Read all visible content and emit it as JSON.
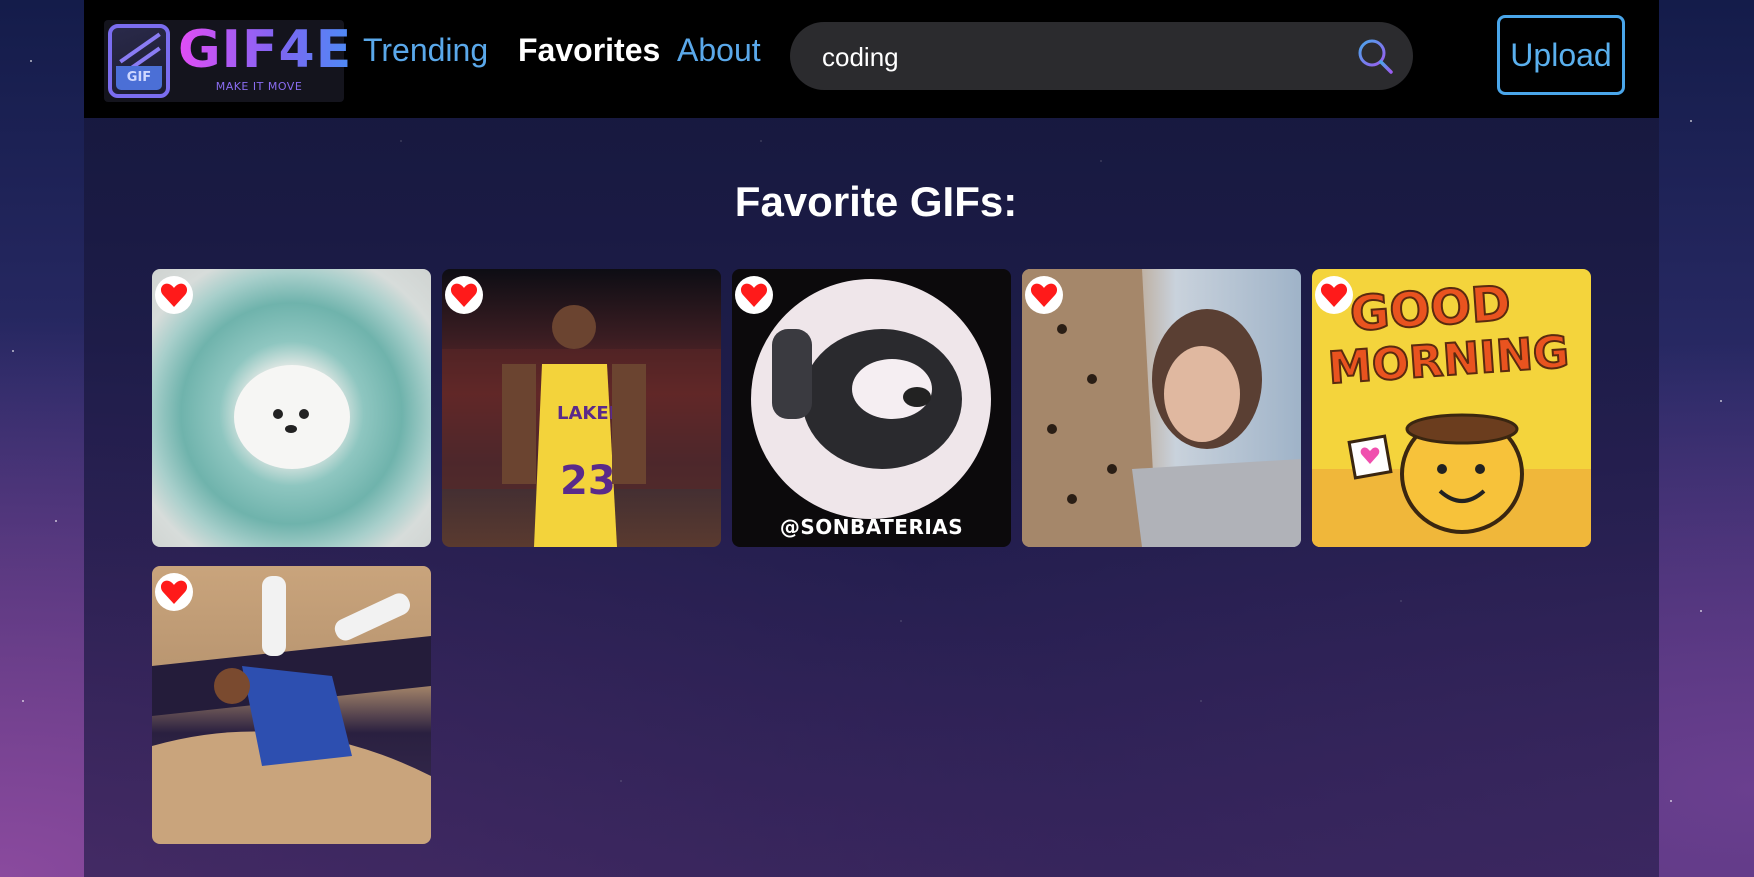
{
  "brand": {
    "logo_word": "GIF4E",
    "logo_tagline": "MAKE IT MOVE",
    "logo_badge": "GIF"
  },
  "nav": {
    "trending": "Trending",
    "favorites": "Favorites",
    "about": "About"
  },
  "search": {
    "value": "coding"
  },
  "upload_label": "Upload",
  "heading": "Favorite GIFs:",
  "gifs": [
    {
      "subject": "fluffy white dog in teal bowl"
    },
    {
      "subject": "basketball player in Lakers 23 jersey"
    },
    {
      "subject": "raccoon waving",
      "caption": "@SONBATERIAS"
    },
    {
      "subject": "cheetah nuzzling woman"
    },
    {
      "subject": "Good Morning tea cup cartoon",
      "line1": "GOOD",
      "line2": "MORNING"
    },
    {
      "subject": "basketball player falling on court"
    }
  ],
  "colors": {
    "accent_blue": "#5aa8ea",
    "heart_red": "#ff1a1a",
    "topbar": "#000000"
  }
}
